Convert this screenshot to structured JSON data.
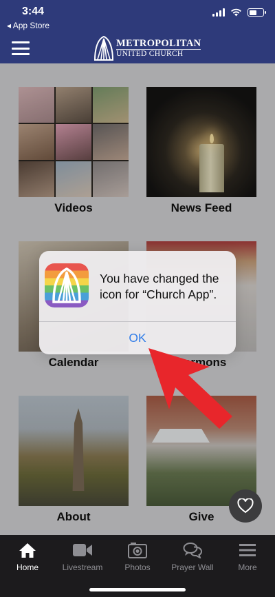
{
  "status_bar": {
    "time": "3:44",
    "back_label": "◂ App Store",
    "battery_level": 0.55
  },
  "header": {
    "logo_line1": "METROPOLITAN",
    "logo_line2": "UNITED CHURCH",
    "icons": {
      "menu": "hamburger-icon"
    }
  },
  "tiles": [
    {
      "label": "Videos"
    },
    {
      "label": "News Feed"
    },
    {
      "label": "Calendar"
    },
    {
      "label": "Sermons"
    },
    {
      "label": "About"
    },
    {
      "label": "Give"
    }
  ],
  "alert": {
    "message": "You have changed the icon for “Church App”.",
    "button_label": "OK",
    "icon": "rainbow-church-icon"
  },
  "fab": {
    "icon": "heart-icon"
  },
  "tabbar": {
    "items": [
      {
        "label": "Home",
        "icon": "home-icon"
      },
      {
        "label": "Livestream",
        "icon": "video-camera-icon"
      },
      {
        "label": "Photos",
        "icon": "camera-icon"
      },
      {
        "label": "Prayer Wall",
        "icon": "chat-bubbles-icon"
      },
      {
        "label": "More",
        "icon": "menu-icon"
      }
    ],
    "active": "Home"
  },
  "colors": {
    "header_bg": "#2e3a7a",
    "page_bg": "#d5d5d7",
    "tabbar_bg": "#1c1b1d",
    "alert_button": "#2f7ce8",
    "arrow": "#e8262b"
  }
}
